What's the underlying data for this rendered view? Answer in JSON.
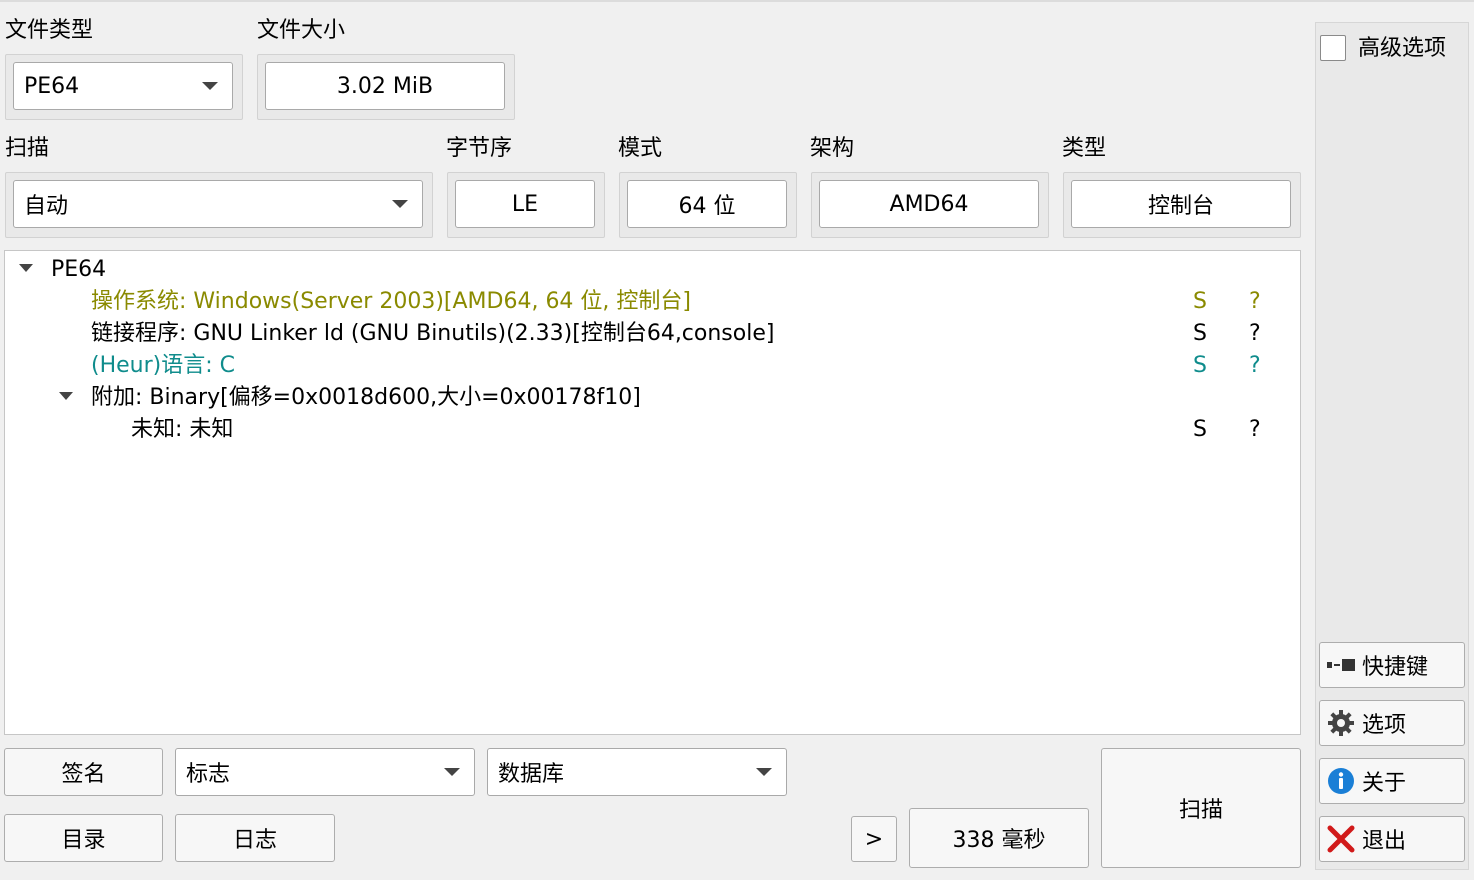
{
  "file_info": {
    "file_type_label": "文件类型",
    "file_type_value": "PE64",
    "file_size_label": "文件大小",
    "file_size_value": "3.02 MiB"
  },
  "scan": {
    "scan_label": "扫描",
    "scan_mode": "自动",
    "endianness_label": "字节序",
    "endianness_value": "LE",
    "mode_label": "模式",
    "mode_value": "64 位",
    "arch_label": "架构",
    "arch_value": "AMD64",
    "type_label": "类型",
    "type_value": "控制台"
  },
  "tree": {
    "root": "PE64",
    "items": [
      {
        "text": "操作系统: Windows(Server 2003)[AMD64, 64 位, 控制台]",
        "col_s": "S",
        "col_q": "?",
        "color": "#8a8a00"
      },
      {
        "text": "链接程序: GNU Linker ld (GNU Binutils)(2.33)[控制台64,console]",
        "col_s": "S",
        "col_q": "?",
        "color": "#000000"
      },
      {
        "text": "(Heur)语言: C",
        "col_s": "S",
        "col_q": "?",
        "color": "#0f8c8c"
      },
      {
        "text": "附加: Binary[偏移=0x0018d600,大小=0x00178f10]",
        "col_s": "",
        "col_q": "",
        "color": "#000000"
      },
      {
        "text": "未知: 未知",
        "col_s": "S",
        "col_q": "?",
        "color": "#000000"
      }
    ]
  },
  "bottom": {
    "signature_btn": "签名",
    "flags_combo": "标志",
    "database_combo": "数据库",
    "directory_btn": "目录",
    "log_btn": "日志",
    "next_btn": ">",
    "elapsed": "338 毫秒",
    "scan_btn": "扫描"
  },
  "side": {
    "advanced_label": "高级选项",
    "shortcuts_btn": "快捷键",
    "options_btn": "选项",
    "about_btn": "关于",
    "exit_btn": "退出"
  },
  "colors": {
    "os_text": "#8a8a00",
    "heur_text": "#0f8c8c",
    "about_icon": "#1a7fd6",
    "exit_icon": "#d11a1a"
  },
  "icons": {
    "shortcuts": "keyboard-icon",
    "options": "gear-icon",
    "about": "info-icon",
    "exit": "close-icon"
  }
}
